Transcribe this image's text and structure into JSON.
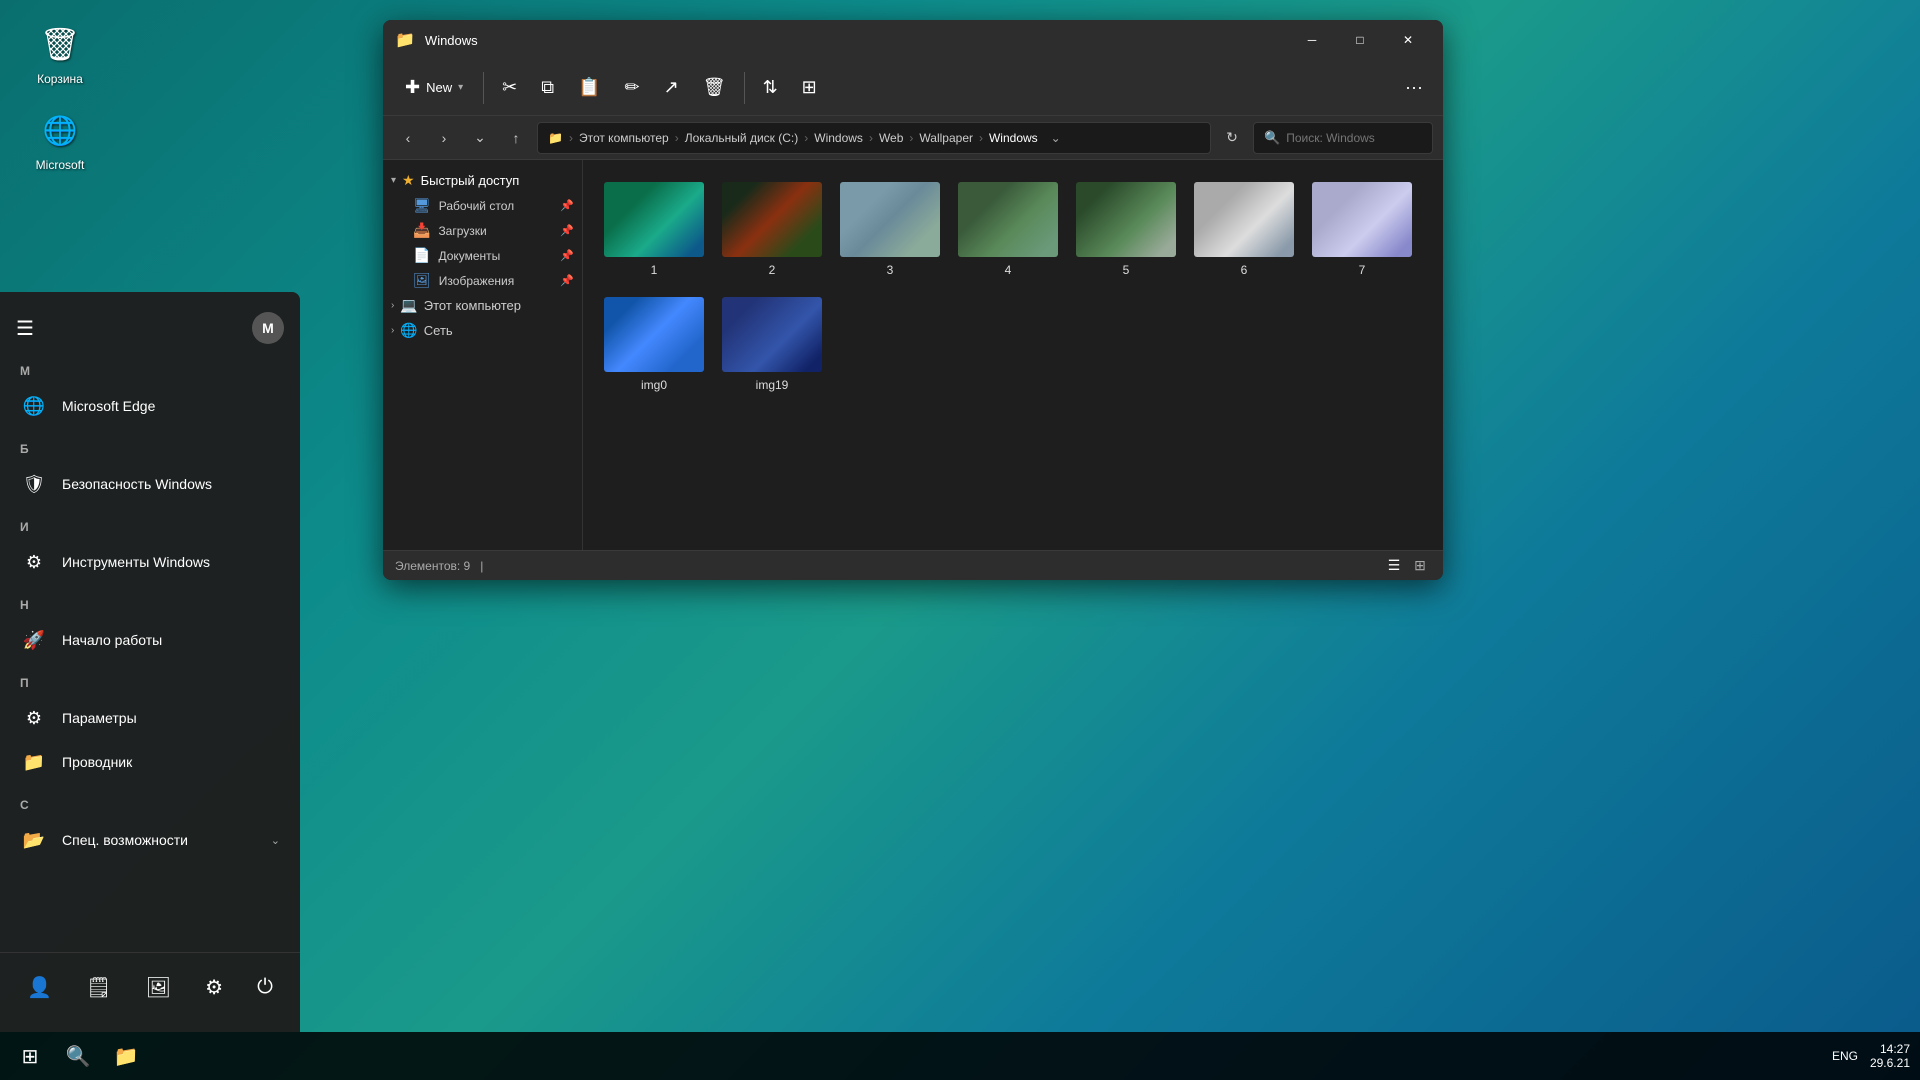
{
  "desktop": {
    "recycle_bin_label": "Корзина",
    "microsoft_edge_label": "Microsoft"
  },
  "start_menu": {
    "user_initial": "M",
    "hamburger": "☰",
    "section_m": "М",
    "section_b": "Б",
    "section_i": "И",
    "section_n": "Н",
    "section_p": "П",
    "section_c": "С",
    "items": [
      {
        "label": "Microsoft Edge",
        "icon": "🌐"
      },
      {
        "label": "Безопасность Windows",
        "icon": "🛡"
      },
      {
        "label": "Инструменты Windows",
        "icon": "⚙"
      },
      {
        "label": "Начало работы",
        "icon": "🚀"
      },
      {
        "label": "Параметры",
        "icon": "⚙"
      },
      {
        "label": "Проводник",
        "icon": "📁"
      },
      {
        "label": "Спец. возможности",
        "icon": "📂"
      }
    ],
    "bottom_items": [
      {
        "icon": "👤",
        "label": ""
      },
      {
        "icon": "🗒",
        "label": ""
      },
      {
        "icon": "🖼",
        "label": ""
      },
      {
        "icon": "⚙",
        "label": ""
      },
      {
        "icon": "⏻",
        "label": ""
      }
    ]
  },
  "file_explorer": {
    "title": "Windows",
    "toolbar": {
      "new_label": "New",
      "new_icon": "✚"
    },
    "breadcrumb": {
      "parts": [
        "Этот компьютер",
        "Локальный диск (C:)",
        "Windows",
        "Web",
        "Wallpaper",
        "Windows"
      ],
      "folder_icon": "📁"
    },
    "search_placeholder": "Поиск: Windows",
    "sidebar": {
      "quick_access_label": "Быстрый доступ",
      "desktop_label": "Рабочий стол",
      "downloads_label": "Загрузки",
      "documents_label": "Документы",
      "images_label": "Изображения",
      "computer_label": "Этот компьютер",
      "network_label": "Сеть"
    },
    "files": [
      {
        "id": "1",
        "label": "1",
        "thumb": "thumb-1"
      },
      {
        "id": "2",
        "label": "2",
        "thumb": "thumb-2"
      },
      {
        "id": "3",
        "label": "3",
        "thumb": "thumb-3"
      },
      {
        "id": "4",
        "label": "4",
        "thumb": "thumb-4"
      },
      {
        "id": "5",
        "label": "5",
        "thumb": "thumb-5"
      },
      {
        "id": "6",
        "label": "6",
        "thumb": "thumb-6"
      },
      {
        "id": "7",
        "label": "7",
        "thumb": "thumb-7"
      },
      {
        "id": "img0",
        "label": "img0",
        "thumb": "thumb-img0"
      },
      {
        "id": "img19",
        "label": "img19",
        "thumb": "thumb-img19"
      }
    ],
    "status_bar": {
      "items_count": "Элементов: 9",
      "cursor": "|"
    }
  },
  "taskbar": {
    "start_icon": "⊞",
    "search_icon": "🔍",
    "explorer_icon": "📁",
    "lang": "ENG",
    "time": "14:27",
    "date": "29.6.21"
  }
}
